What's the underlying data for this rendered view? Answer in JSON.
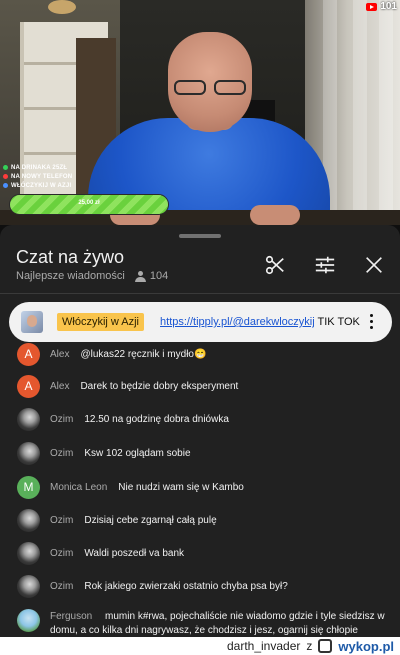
{
  "video": {
    "viewer_count": "101",
    "goals": [
      {
        "text": "NA DRINAKA 25ZŁ",
        "color": "#34d058"
      },
      {
        "text": "NA NOWY TELEFON",
        "color": "#ff3b3b"
      },
      {
        "text": "WŁÓCZYKIJ W AZJI",
        "color": "#4a90ff"
      }
    ],
    "progress_text": "25,00 zł",
    "progress_fraction": 1.0
  },
  "chat": {
    "title": "Czat na żywo",
    "subtitle": "Najlepsze wiadomości",
    "viewers": "104",
    "icons": [
      "scissors-icon",
      "tune-icon",
      "close-icon"
    ],
    "pinned": {
      "badge": "Włóczykij w Azji",
      "link": "https://tipply.pl/@darekwloczykij",
      "text": " TIK TOK - da..."
    },
    "messages": [
      {
        "author": "Alex",
        "initial": "A",
        "color": "#e4572e",
        "text": "@lukas22 ręcznik i mydło😁"
      },
      {
        "author": "Alex",
        "initial": "A",
        "color": "#e4572e",
        "text": "Darek to będzie dobry eksperyment"
      },
      {
        "author": "Ozim",
        "initial": "",
        "color": "",
        "text": "12.50 na godzinę dobra dniówka"
      },
      {
        "author": "Ozim",
        "initial": "",
        "color": "",
        "text": "Ksw 102 oglądam sobie"
      },
      {
        "author": "Monica Leon",
        "initial": "M",
        "color": "#59b05a",
        "text": "Nie nudzi wam się w Kambo"
      },
      {
        "author": "Ozim",
        "initial": "",
        "color": "",
        "text": "Dzisiaj cebe zgarnął całą pulę"
      },
      {
        "author": "Ozim",
        "initial": "",
        "color": "",
        "text": "Waldi poszedł va bank"
      },
      {
        "author": "Ozim",
        "initial": "",
        "color": "",
        "text": "Rok jakiego zwierzaki ostatnio chyba psa był?"
      }
    ],
    "last_message": {
      "author": "Ferguson",
      "text": "mumin k#rwa, pojechaliście nie wiadomo gdzie i tyle siedzisz w domu, a co kilka dni nagrywasz, że chodzisz i jesz, ogarnij się chłopie"
    }
  },
  "watermark": {
    "user": "darth_invader",
    "separator": "z",
    "site": "wykop.pl"
  }
}
